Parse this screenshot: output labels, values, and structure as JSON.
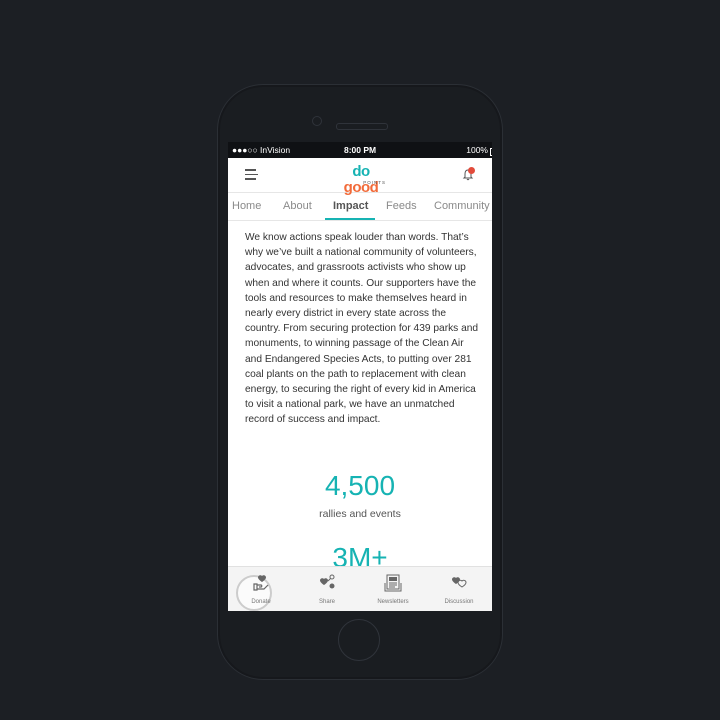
{
  "status_bar": {
    "carrier": "●●●○○ InVision",
    "time": "8:00 PM",
    "battery": "100%"
  },
  "header": {
    "logo_part1": "do",
    "logo_part2": "good",
    "logo_sub": "POINTS",
    "notification_count": "1"
  },
  "tabs": [
    "Home",
    "About",
    "Impact",
    "Feeds",
    "Community"
  ],
  "active_tab": "Impact",
  "content": {
    "paragraph": "We know actions speak louder than words. That’s why we’ve built a national community of volunteers, advocates, and grassroots activists who show up when and where it counts. Our supporters have the tools and resources to make themselves heard in nearly every district in every state across the country. From securing protection for 439 parks and monuments, to winning passage of the Clean Air and Endangered Species Acts, to putting over 281 coal plants on the path to replacement with clean energy, to securing the right of every kid in America to visit a national park, we have an unmatched record of success and impact.",
    "stats": [
      {
        "value": "4,500",
        "label": "rallies and events"
      },
      {
        "value": "3M+",
        "label": ""
      }
    ]
  },
  "bottom_nav": [
    {
      "label": "Donate",
      "icon": "donate-icon"
    },
    {
      "label": "Share",
      "icon": "share-icon"
    },
    {
      "label": "Newsletters",
      "icon": "newsletter-icon"
    },
    {
      "label": "Discussion",
      "icon": "discussion-icon"
    }
  ],
  "colors": {
    "accent": "#16b3b3",
    "brand_orange": "#f26b3a",
    "background": "#1c1f24"
  }
}
